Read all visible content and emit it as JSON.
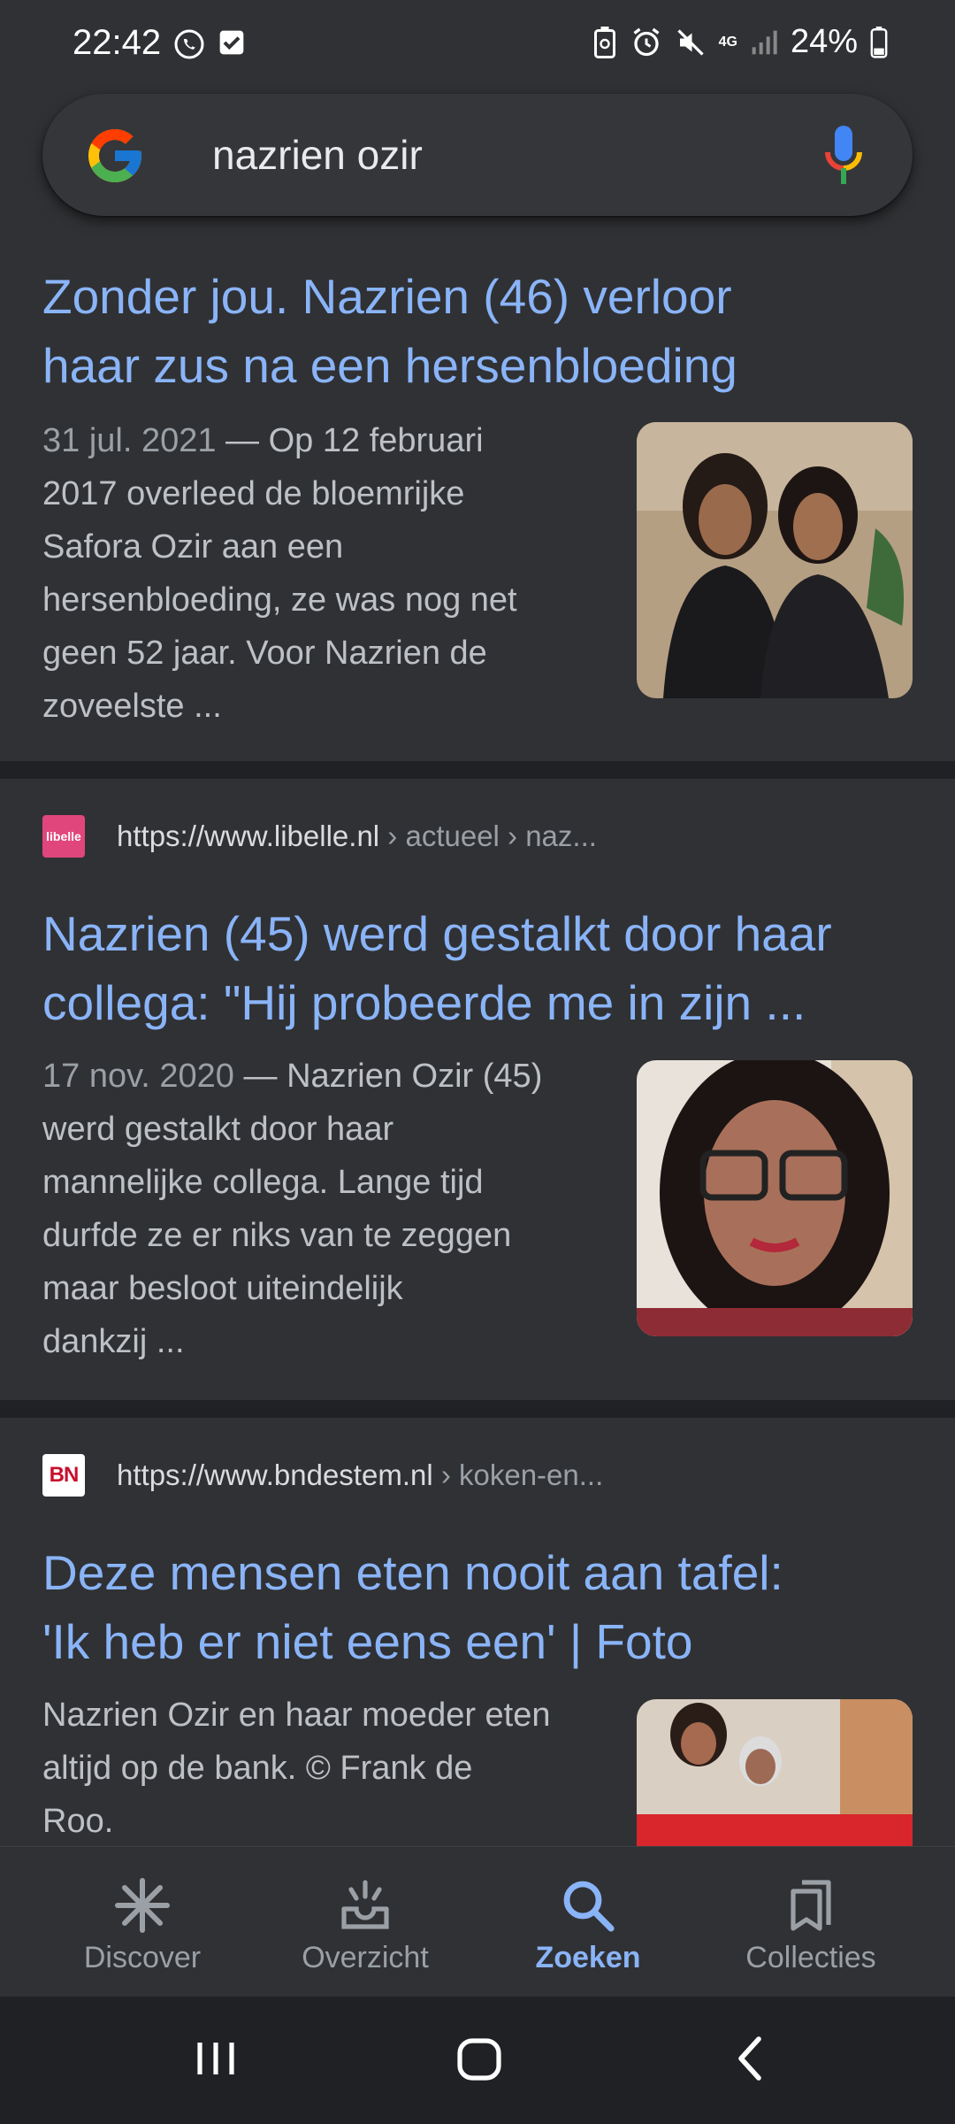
{
  "status_bar": {
    "time": "22:42",
    "battery": "24%",
    "network": "4G"
  },
  "search": {
    "query": "nazrien ozir"
  },
  "results": [
    {
      "title_lines": [
        "Zonder jou. Nazrien (46) verloor",
        "haar zus na een hersenbloeding"
      ],
      "date": "31 jul. 2021",
      "snippet_lines": [
        "Op 12 februari",
        "2017 overleed de bloemrijke",
        "Safora Ozir aan een",
        "hersenbloeding, ze was nog net",
        "geen 52 jaar. Voor Nazrien de",
        "zoveelste ..."
      ]
    },
    {
      "url_domain": "https://www.libelle.nl",
      "url_path": " › actueel › naz...",
      "favicon_text": "libelle",
      "title_lines": [
        "Nazrien (45) werd gestalkt door haar",
        "collega: \"Hij probeerde me in zijn ..."
      ],
      "date": "17 nov. 2020",
      "snippet_lines": [
        "Nazrien Ozir (45)",
        "werd gestalkt door haar",
        "mannelijke collega. Lange tijd",
        "durfde ze er niks van te zeggen",
        "maar besloot uiteindelijk",
        "dankzij ..."
      ]
    },
    {
      "url_domain": "https://www.bndestem.nl",
      "url_path": " › koken-en...",
      "favicon_text": "BN",
      "title_lines": [
        "Deze mensen eten nooit aan tafel:",
        "'Ik heb er niet eens een' | Foto"
      ],
      "snippet_lines": [
        "Nazrien Ozir en haar moeder eten",
        "altijd op de bank. © Frank de",
        "Roo."
      ]
    }
  ],
  "bottom_nav": [
    {
      "label": "Discover",
      "icon": "asterisk-icon",
      "active": false
    },
    {
      "label": "Overzicht",
      "icon": "overview-icon",
      "active": false
    },
    {
      "label": "Zoeken",
      "icon": "search-icon",
      "active": true
    },
    {
      "label": "Collecties",
      "icon": "collections-icon",
      "active": false
    }
  ],
  "colors": {
    "background": "#303134",
    "link": "#8ab4f8",
    "snippet": "#bdc1c6",
    "active_nav": "#8ab4f8"
  }
}
